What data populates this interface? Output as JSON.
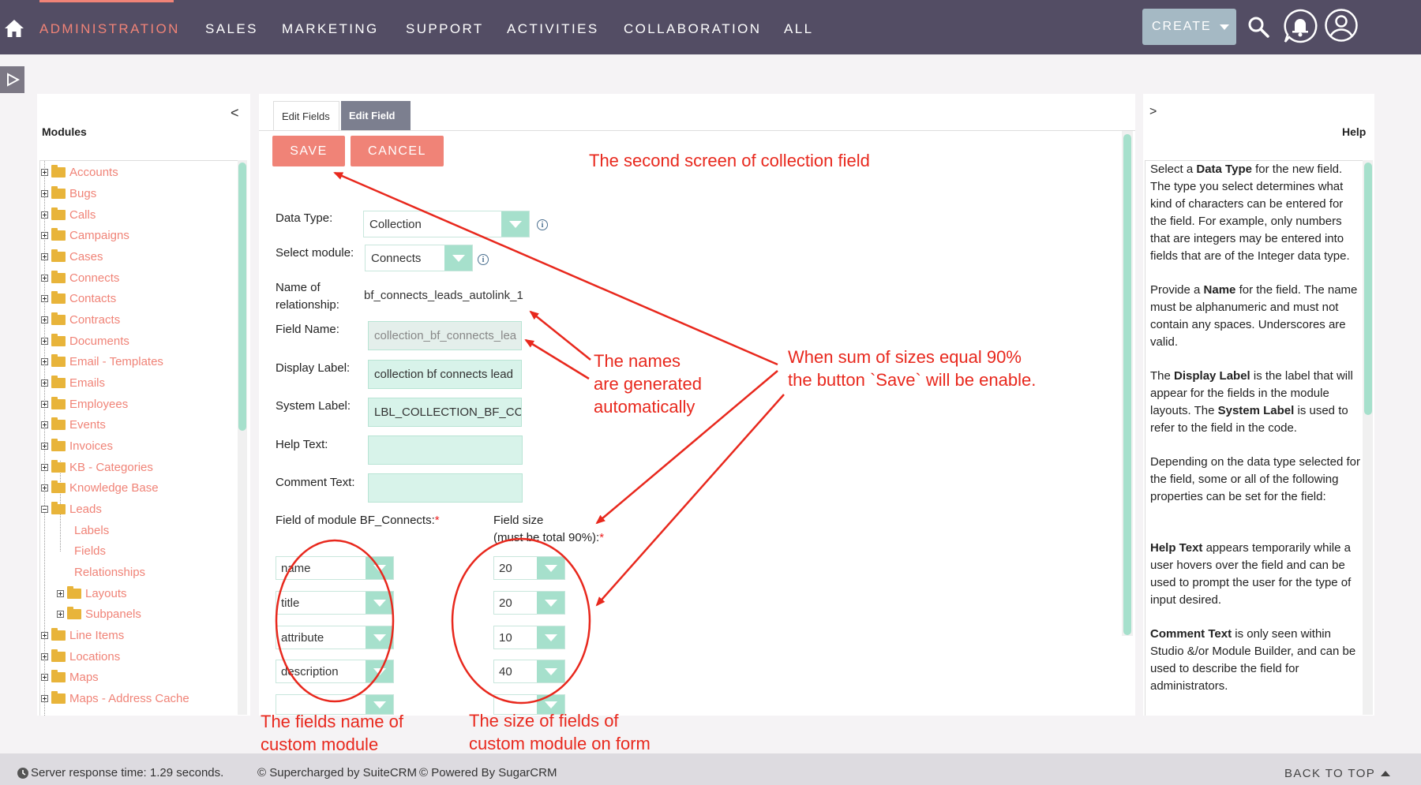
{
  "nav": {
    "items": [
      "ADMINISTRATION",
      "SALES",
      "MARKETING",
      "SUPPORT",
      "ACTIVITIES",
      "COLLABORATION",
      "ALL"
    ],
    "create_label": "CREATE"
  },
  "modules": {
    "title": "Modules",
    "collapse": "<",
    "items": [
      "Accounts",
      "Bugs",
      "Calls",
      "Campaigns",
      "Cases",
      "Connects",
      "Contacts",
      "Contracts",
      "Documents",
      "Email - Templates",
      "Emails",
      "Employees",
      "Events",
      "Invoices",
      "KB - Categories",
      "Knowledge Base",
      "Leads"
    ],
    "leads_children": [
      "Labels",
      "Fields",
      "Relationships",
      "Layouts",
      "Subpanels"
    ],
    "after_items": [
      "Line Items",
      "Locations",
      "Maps",
      "Maps - Address Cache"
    ]
  },
  "tabs": {
    "edit_fields": "Edit Fields",
    "edit_field": "Edit Field"
  },
  "buttons": {
    "save": "SAVE",
    "cancel": "CANCEL"
  },
  "form": {
    "data_type_label": "Data Type:",
    "data_type_value": "Collection",
    "select_module_label": "Select module:",
    "select_module_value": "Connects",
    "relationship_label_1": "Name of",
    "relationship_label_2": "relationship:",
    "relationship_value": "bf_connects_leads_autolink_1",
    "field_name_label": "Field Name:",
    "field_name_value": "collection_bf_connects_lea",
    "display_label_label": "Display Label:",
    "display_label_value": "collection bf connects lead",
    "system_label_label": "System Label:",
    "system_label_value": "LBL_COLLECTION_BF_CC",
    "help_text_label": "Help Text:",
    "comment_text_label": "Comment Text:",
    "fields_col_label": "Field of module BF_Connects:",
    "size_col_label_1": "Field size",
    "size_col_label_2": "(must be total 90%):",
    "required": "*",
    "fields": [
      "name",
      "title",
      "attribute",
      "description",
      ""
    ],
    "sizes": [
      "20",
      "20",
      "10",
      "40",
      ""
    ]
  },
  "annotations": {
    "second_screen": "The second screen of collection field",
    "names_1": "The names",
    "names_2": "are generated",
    "names_3": "automatically",
    "sum_1": "When sum of sizes equal 90%",
    "sum_2": "the button `Save` will be enable.",
    "fields_1": "The fields name of",
    "fields_2": "custom module",
    "size_1": "The size of  fields of",
    "size_2": "custom module on form"
  },
  "help": {
    "collapse": ">",
    "title": "Help",
    "p1": [
      "Select a ",
      "Data Type",
      " for the new field. The type you select determines what kind of characters can be entered for the field. For example, only numbers that are integers may be entered into fields that are of the Integer data type."
    ],
    "p2": [
      "Provide a ",
      "Name",
      " for the field. The name must be alphanumeric and must not contain any spaces. Underscores are valid."
    ],
    "p3": [
      "The ",
      "Display Label",
      " is the label that will appear for the fields in the module layouts. The ",
      "System Label",
      " is used to refer to the field in the code."
    ],
    "p4": "Depending on the data type selected for the field, some or all of the following properties can be set for the field:",
    "p5": [
      "Help Text",
      " appears temporarily while a user hovers over the field and can be used to prompt the user for the type of input desired."
    ],
    "p6": [
      "Comment Text",
      " is only seen within Studio &/or Module Builder, and can be used to describe the field for administrators."
    ]
  },
  "footer": {
    "response": "Server response time: 1.29 seconds.",
    "suitecrm": "© Supercharged by SuiteCRM",
    "sugarcrm": "© Powered By SugarCRM",
    "back_to_top": "BACK TO TOP"
  },
  "colors": {
    "nav_bg": "#534d64",
    "accent": "#f08377",
    "field_bg": "#d8f3ea",
    "annotation": "#e8281d"
  }
}
